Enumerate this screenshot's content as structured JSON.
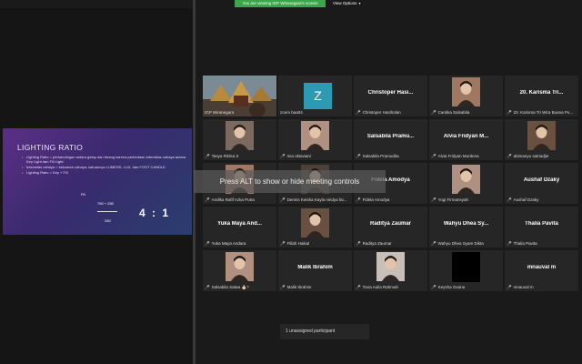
{
  "topbar": {
    "viewing_label": "You are viewing IGP Wiranegara's screen",
    "view_options_label": "View Options"
  },
  "slide": {
    "title": "LIGHTING RATIO",
    "bullets": [
      "Lighting Ratio = perbandingan antara gelap dan terang karena perbedaan intensitas cahaya antara Key Light dan Fill Light.",
      "Intensitas cahaya = kekuatan cahaya, satuannya LUMENS, LUX, dan FOOT CANDLE.",
      "Lighting Ratio = Key + Fill"
    ],
    "fill_label": "Fill",
    "fraction_top": "750 + 250",
    "fraction_bottom": "250",
    "ratio": "4 : 1"
  },
  "participants": [
    {
      "name": "IGP Wiranegara",
      "big": "",
      "kind": "video-temple",
      "active": true,
      "muted": false
    },
    {
      "name": "zoom baa04",
      "big": "",
      "kind": "avatar-z",
      "active": false,
      "muted": false
    },
    {
      "name": "Christoper Hasiholan",
      "big": "Christoper Hasi...",
      "kind": "name",
      "active": false,
      "muted": true
    },
    {
      "name": "Cantika Salsabila",
      "big": "",
      "kind": "photo",
      "active": false,
      "muted": true
    },
    {
      "name": "20. Karisma Tri Wira Buana Pu...",
      "big": "20. Karisma Tri...",
      "kind": "name",
      "active": false,
      "muted": true
    },
    {
      "name": "Tasya Ritzka S",
      "big": "",
      "kind": "photo",
      "active": false,
      "muted": true
    },
    {
      "name": "mia oktaviani",
      "big": "",
      "kind": "photo",
      "active": false,
      "muted": true
    },
    {
      "name": "Salsabila Pramudita",
      "big": "Salsabila Pramu...",
      "kind": "name",
      "active": false,
      "muted": true
    },
    {
      "name": "Alvia Fridyan Murdena",
      "big": "Alvia Fridyan M...",
      "kind": "name",
      "active": false,
      "muted": true
    },
    {
      "name": "abimanyu satriadjie",
      "big": "",
      "kind": "photo",
      "active": false,
      "muted": true
    },
    {
      "name": "Andika Rafif Azka Putra",
      "big": "",
      "kind": "photo",
      "active": false,
      "muted": true
    },
    {
      "name": "Dennis Keisha Kayla nindya fai...",
      "big": "",
      "kind": "photo",
      "active": false,
      "muted": true
    },
    {
      "name": "Fidela Amodya",
      "big": "Fidela Amodya",
      "kind": "name",
      "active": false,
      "muted": true
    },
    {
      "name": "Yogi Firmansyah",
      "big": "",
      "kind": "photo",
      "active": false,
      "muted": true
    },
    {
      "name": "Aushaf Dzaky",
      "big": "Aushaf Dzaky",
      "kind": "name",
      "active": false,
      "muted": true
    },
    {
      "name": "Yuka Maya Andara",
      "big": "Yuka Maya And...",
      "kind": "name",
      "active": false,
      "muted": true
    },
    {
      "name": "Fillah Haikal",
      "big": "",
      "kind": "photo",
      "active": false,
      "muted": true
    },
    {
      "name": "Raditya Zaumar",
      "big": "Raditya Zaumar",
      "kind": "name",
      "active": false,
      "muted": true
    },
    {
      "name": "Wahyu Dhea Syam Dikta",
      "big": "Wahyu Dhea Sy...",
      "kind": "name",
      "active": false,
      "muted": true
    },
    {
      "name": "Thalia Pavita",
      "big": "Thalia Pavita",
      "kind": "name",
      "active": false,
      "muted": true
    },
    {
      "name": "Salsabila Salwa 🎂?",
      "big": "",
      "kind": "photo",
      "active": false,
      "muted": true
    },
    {
      "name": "Malik Ibrahim",
      "big": "Malik Ibrahim",
      "kind": "name",
      "active": false,
      "muted": true
    },
    {
      "name": "Tiara Aulia Rahmah",
      "big": "",
      "kind": "photo",
      "active": false,
      "muted": true
    },
    {
      "name": "Keysha Oxana",
      "big": "",
      "kind": "black",
      "active": false,
      "muted": true
    },
    {
      "name": "mnauval m",
      "big": "mnauval m",
      "kind": "name",
      "active": false,
      "muted": true
    }
  ],
  "meeting_controls_hint": "Press ALT to show or hide meeting controls",
  "unassigned_label": "1 unassigned participant",
  "colors": {
    "viewing_banner": "#3aa54a",
    "active_speaker_border": "#c8d84a",
    "muted_icon": "#e0463c",
    "z_avatar": "#2d9ab4"
  }
}
